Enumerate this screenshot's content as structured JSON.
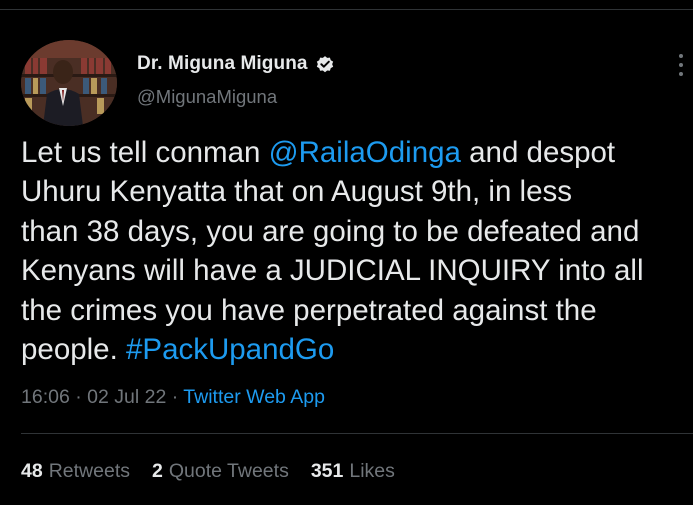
{
  "author": {
    "display_name": "Dr. Miguna Miguna",
    "handle": "@MigunaMiguna",
    "verified_icon": "verified-badge-icon"
  },
  "tweet": {
    "lines": [
      [
        {
          "text": "Let us tell conman ",
          "type": "text"
        },
        {
          "text": "@RailaOdinga",
          "type": "mention"
        },
        {
          "text": " and despot",
          "type": "text"
        }
      ],
      [
        {
          "text": "Uhuru Kenyatta that on August 9th, in less",
          "type": "text"
        }
      ],
      [
        {
          "text": "than 38 days, you are going to be defeated and",
          "type": "text"
        }
      ],
      [
        {
          "text": "Kenyans will have a JUDICIAL INQUIRY into all",
          "type": "text"
        }
      ],
      [
        {
          "text": "the crimes you have perpetrated against the",
          "type": "text"
        }
      ],
      [
        {
          "text": "people. ",
          "type": "text"
        },
        {
          "text": "#PackUpandGo",
          "type": "hashtag"
        }
      ]
    ]
  },
  "meta": {
    "time": "16:06",
    "separator": " · ",
    "date": "02 Jul 22",
    "source": "Twitter Web App"
  },
  "stats": {
    "retweets_count": "48",
    "retweets_label": "Retweets",
    "quotes_count": "2",
    "quotes_label": "Quote Tweets",
    "likes_count": "351",
    "likes_label": "Likes"
  },
  "colors": {
    "background": "#000000",
    "text": "#e7e9ea",
    "secondary": "#71767b",
    "link": "#1d9bf0",
    "divider": "#2f3336"
  }
}
